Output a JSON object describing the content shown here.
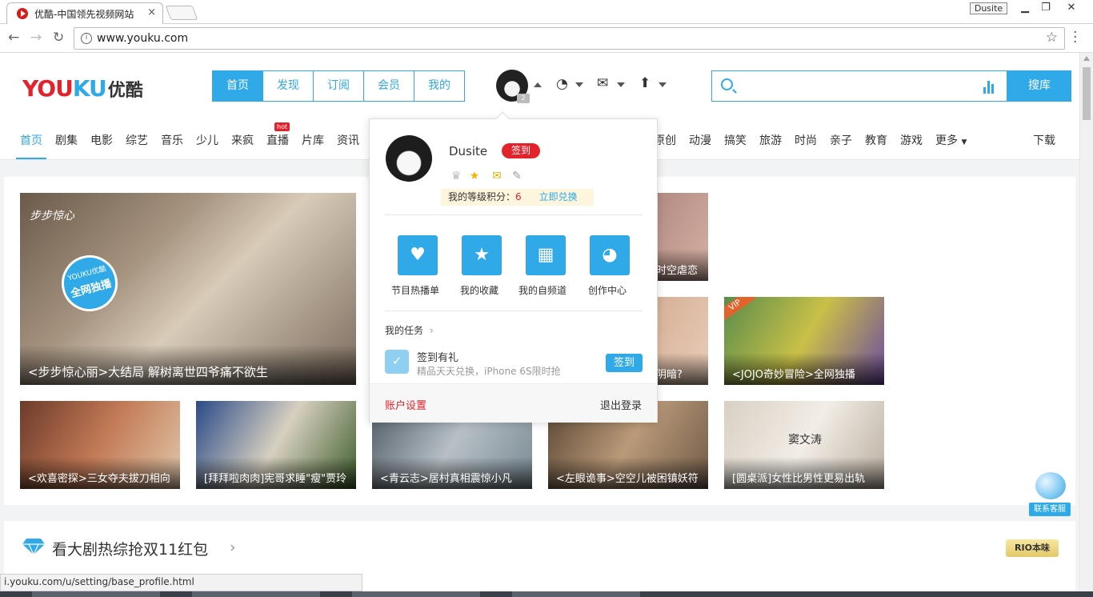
{
  "browser": {
    "tab_title": "优酷-中国领先视频网站",
    "tab_close": "×",
    "user_badge": "Dusite",
    "url": "www.youku.com",
    "status_url": "i.youku.com/u/setting/base_profile.html"
  },
  "header": {
    "logo_latin_1": "YOU",
    "logo_latin_2": "KU",
    "logo_cn": "优酷",
    "nav": [
      "首页",
      "发现",
      "订阅",
      "会员",
      "我的"
    ],
    "search_button": "搜库",
    "avatar_level": "2"
  },
  "subnav": {
    "channels": [
      "首页",
      "剧集",
      "电影",
      "综艺",
      "音乐",
      "少儿",
      "来疯",
      "直播",
      "片库",
      "资讯"
    ],
    "channels_right": [
      "原创",
      "动漫",
      "搞笑",
      "旅游",
      "时尚",
      "亲子",
      "教育",
      "游戏"
    ],
    "more": "更多",
    "download": "下载",
    "hot_badge": "hot"
  },
  "content": {
    "big_caption": "<步步惊心丽>大结局 解树离世四爷痛不欲生",
    "big_badge": "全网独播",
    "big_badge_brand": "YOUKU优酷",
    "big_corner": "步步惊心",
    "partial_caption_1": "时空虐恋",
    "partial_caption_2": "阴暗?",
    "jojo_caption": "<JOJO奇妙冒险>全网独播",
    "vip": "VIP",
    "row2": [
      "<欢喜密探>三女夺夫拔刀相向",
      "[拜拜啦肉肉]宪哥求睡\"瘦\"贾玲",
      "<青云志>居村真相震惊小凡",
      "<左眼诡事>空空儿被困镇妖符",
      "[圆桌派]女性比男性更易出轨"
    ],
    "section_title": "看大剧热综抢双11红包",
    "section_chevron": "›",
    "rio": "RIO本味",
    "service": "联系客服",
    "poster_text": "窦文涛"
  },
  "dropdown": {
    "username": "Dusite",
    "sign_label": "签到",
    "points_label": "我的等级积分：",
    "points_value": "6",
    "exchange": "立即兑换",
    "tiles": [
      "节目热播单",
      "我的收藏",
      "我的自频道",
      "创作中心"
    ],
    "tasks_label": "我的任务",
    "tasks_chevron": "›",
    "task_title": "签到有礼",
    "task_desc": "精品天天兑换，iPhone 6S限时抢",
    "task_button": "签到",
    "account_settings": "账户设置",
    "logout": "退出登录"
  },
  "colors": {
    "accent": "#2fa9e8",
    "red": "#e3232c"
  }
}
